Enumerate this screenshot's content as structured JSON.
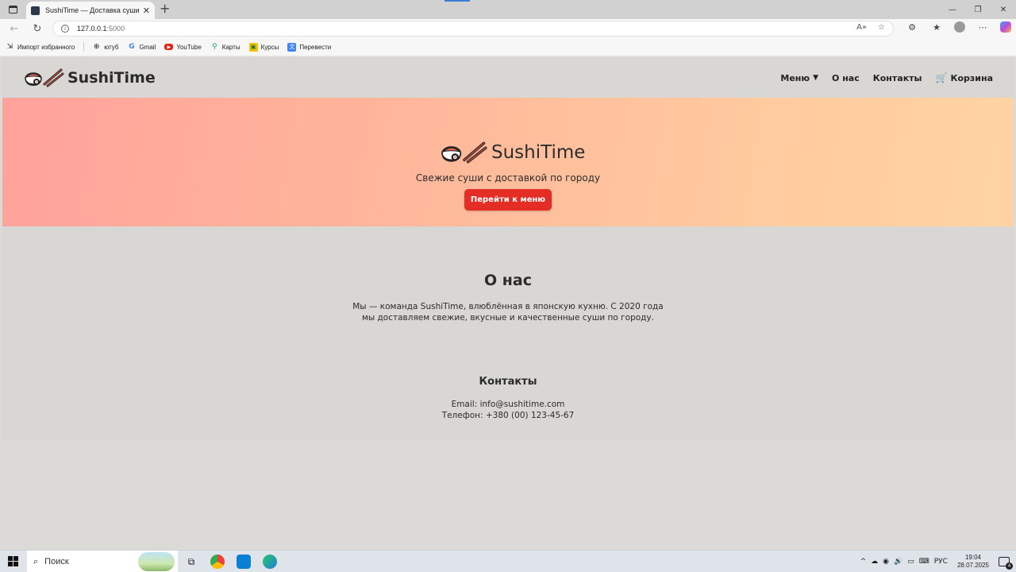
{
  "browser": {
    "tab_title": "SushiTime — Доставка суши",
    "url_host": "127.0.0.1",
    "url_port": ":5000",
    "bookmarks": [
      {
        "label": "Импорт избранного",
        "icon": "import-icon"
      },
      {
        "label": "ютуб",
        "icon": "globe-icon"
      },
      {
        "label": "Gmail",
        "icon": "google-icon"
      },
      {
        "label": "YouTube",
        "icon": "youtube-icon"
      },
      {
        "label": "Карты",
        "icon": "maps-icon"
      },
      {
        "label": "Курсы",
        "icon": "courses-icon"
      },
      {
        "label": "Перевести",
        "icon": "translate-icon"
      }
    ]
  },
  "site": {
    "brand": "SushiTime",
    "nav": {
      "menu": "Меню",
      "about": "О нас",
      "contacts": "Контакты",
      "cart": "Корзина"
    },
    "hero": {
      "brand": "SushiTime",
      "tagline": "Свежие суши с доставкой по городу",
      "button": "Перейти к меню"
    },
    "about": {
      "title": "О нас",
      "text": "Мы — команда SushiTime, влюблённая в японскую кухню. С 2020 года мы доставляем свежие, вкусные и качественные суши по городу."
    },
    "contacts": {
      "title": "Контакты",
      "email": "Email: info@sushitime.com",
      "phone": "Телефон: +380 (00) 123-45-67"
    },
    "colors": {
      "accent": "#e32d25",
      "hero_gradient_start": "#ffa29c",
      "hero_gradient_end": "#ffd4a2"
    }
  },
  "taskbar": {
    "search_placeholder": "Поиск",
    "language": "РУС",
    "time": "19:04",
    "date": "28.07.2025",
    "notifications": "4"
  }
}
